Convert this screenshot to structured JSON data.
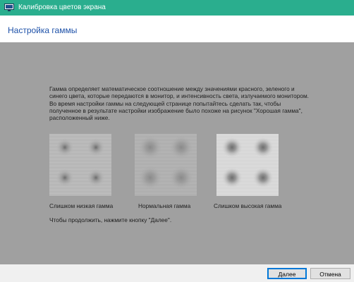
{
  "window": {
    "title": "Калибровка цветов экрана"
  },
  "header": {
    "title": "Настройка гаммы"
  },
  "description": {
    "paragraph1": "Гамма определяет математическое соотношение между значениями красного, зеленого и синего цвета, которые передаются в монитор, и интенсивность света, излучаемого монитором.",
    "paragraph2": "Во время настройки гаммы на следующей странице попытайтесь сделать так, чтобы полученное в результате настройки изображение было похоже на рисунок \"Хорошая гамма\", расположенный ниже."
  },
  "samples": [
    {
      "label": "Слишком низкая гамма"
    },
    {
      "label": "Нормальная гамма"
    },
    {
      "label": "Слишком высокая гамма"
    }
  ],
  "instruction": "Чтобы продолжить, нажмите кнопку \"Далее\".",
  "buttons": {
    "next": "Далее",
    "cancel": "Отмена"
  },
  "colors": {
    "titlebar": "#2aae8e",
    "header_text": "#1c50a8",
    "content_bg": "#a0a0a0",
    "footer_bg": "#f0f0f0",
    "focus_border": "#0078d7"
  }
}
